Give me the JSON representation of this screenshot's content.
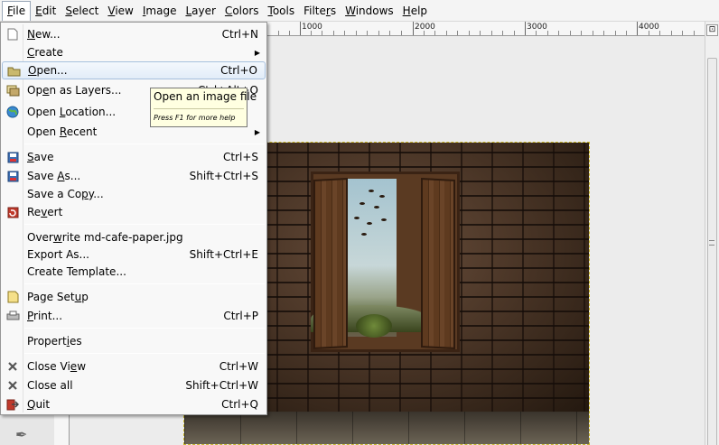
{
  "menubar": {
    "items": [
      {
        "pre": "",
        "mn": "F",
        "post": "ile"
      },
      {
        "pre": "",
        "mn": "E",
        "post": "dit"
      },
      {
        "pre": "",
        "mn": "S",
        "post": "elect"
      },
      {
        "pre": "",
        "mn": "V",
        "post": "iew"
      },
      {
        "pre": "",
        "mn": "I",
        "post": "mage"
      },
      {
        "pre": "",
        "mn": "L",
        "post": "ayer"
      },
      {
        "pre": "",
        "mn": "C",
        "post": "olors"
      },
      {
        "pre": "",
        "mn": "T",
        "post": "ools"
      },
      {
        "pre": "Filte",
        "mn": "r",
        "post": "s"
      },
      {
        "pre": "",
        "mn": "W",
        "post": "indows"
      },
      {
        "pre": "",
        "mn": "H",
        "post": "elp"
      }
    ]
  },
  "ruler": {
    "labels": [
      "1000",
      "2000",
      "3000",
      "4000"
    ]
  },
  "file_menu": {
    "new": {
      "pre": "",
      "mn": "N",
      "post": "ew...",
      "shortcut": "Ctrl+N",
      "icon": "new-file-icon"
    },
    "create": {
      "pre": "",
      "mn": "C",
      "post": "reate",
      "arrow": "▶"
    },
    "open": {
      "pre": "",
      "mn": "O",
      "post": "pen...",
      "shortcut": "Ctrl+O",
      "icon": "folder-open-icon"
    },
    "open_layers": {
      "pre": "Op",
      "mn": "e",
      "post": "n as Layers...",
      "shortcut": "Ctrl+Alt+O",
      "icon": "open-layers-icon"
    },
    "open_location": {
      "pre": "Open ",
      "mn": "L",
      "post": "ocation...",
      "icon": "globe-icon"
    },
    "open_recent": {
      "pre": "Open ",
      "mn": "R",
      "post": "ecent",
      "arrow": "▶"
    },
    "save": {
      "pre": "",
      "mn": "S",
      "post": "ave",
      "shortcut": "Ctrl+S",
      "icon": "save-icon"
    },
    "save_as": {
      "pre": "Save ",
      "mn": "A",
      "post": "s...",
      "shortcut": "Shift+Ctrl+S",
      "icon": "save-as-icon"
    },
    "save_copy": {
      "pre": "Save a Co",
      "mn": "p",
      "post": "y..."
    },
    "revert": {
      "pre": "Re",
      "mn": "v",
      "post": "ert",
      "icon": "revert-icon"
    },
    "overwrite": {
      "pre": "Over",
      "mn": "w",
      "post": "rite md-cafe-paper.jpg"
    },
    "export_as": {
      "pre": "Export As...",
      "mn": "",
      "post": "",
      "shortcut": "Shift+Ctrl+E"
    },
    "template": {
      "pre": "Create Template...",
      "mn": "",
      "post": ""
    },
    "page_setup": {
      "pre": "Page Set",
      "mn": "u",
      "post": "p",
      "icon": "page-setup-icon"
    },
    "print": {
      "pre": "",
      "mn": "P",
      "post": "rint...",
      "shortcut": "Ctrl+P",
      "icon": "print-icon"
    },
    "properties": {
      "pre": "Propert",
      "mn": "i",
      "post": "es"
    },
    "close_view": {
      "pre": "Close Vi",
      "mn": "e",
      "post": "w",
      "shortcut": "Ctrl+W",
      "icon": "close-x-icon"
    },
    "close_all": {
      "pre": "Close all",
      "mn": "",
      "post": "",
      "shortcut": "Shift+Ctrl+W",
      "icon": "close-x-icon"
    },
    "quit": {
      "pre": "",
      "mn": "Q",
      "post": "uit",
      "shortcut": "Ctrl+Q",
      "icon": "quit-icon"
    }
  },
  "tooltip": {
    "title": "Open an image file",
    "hint": "Press F1 for more help"
  },
  "colors": {
    "menu_highlight": "#e2ecf8",
    "tooltip_bg": "#ffffe1",
    "selection_border": "#c9b62a"
  }
}
